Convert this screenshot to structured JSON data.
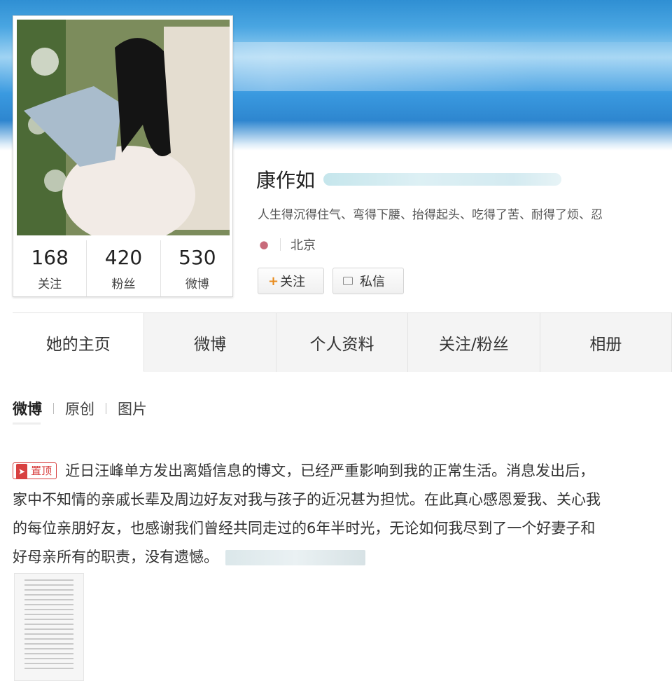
{
  "profile": {
    "name": "康作如",
    "bio": "人生得沉得住气、弯得下腰、抬得起头、吃得了苦、耐得了烦、忍",
    "location": "北京",
    "stats": [
      {
        "value": "168",
        "label": "关注"
      },
      {
        "value": "420",
        "label": "粉丝"
      },
      {
        "value": "530",
        "label": "微博"
      }
    ],
    "follow_label": "关注",
    "message_label": "私信"
  },
  "tabs": [
    "她的主页",
    "微博",
    "个人资料",
    "关注/粉丝",
    "相册"
  ],
  "subtabs": [
    "微博",
    "原创",
    "图片"
  ],
  "post": {
    "pin_label": "置顶",
    "lines": [
      "近日汪峰单方发出离婚信息的博文，已经严重影响到我的正常生活。消息发出后，",
      "家中不知情的亲戚长辈及周边好友对我与孩子的近况甚为担忧。在此真心感恩爱我、关心我",
      "的每位亲朋好友，也感谢我们曾经共同走过的6年半时光，无论如何我尽到了一个好妻子和",
      "好母亲所有的职责，没有遗憾。"
    ]
  }
}
